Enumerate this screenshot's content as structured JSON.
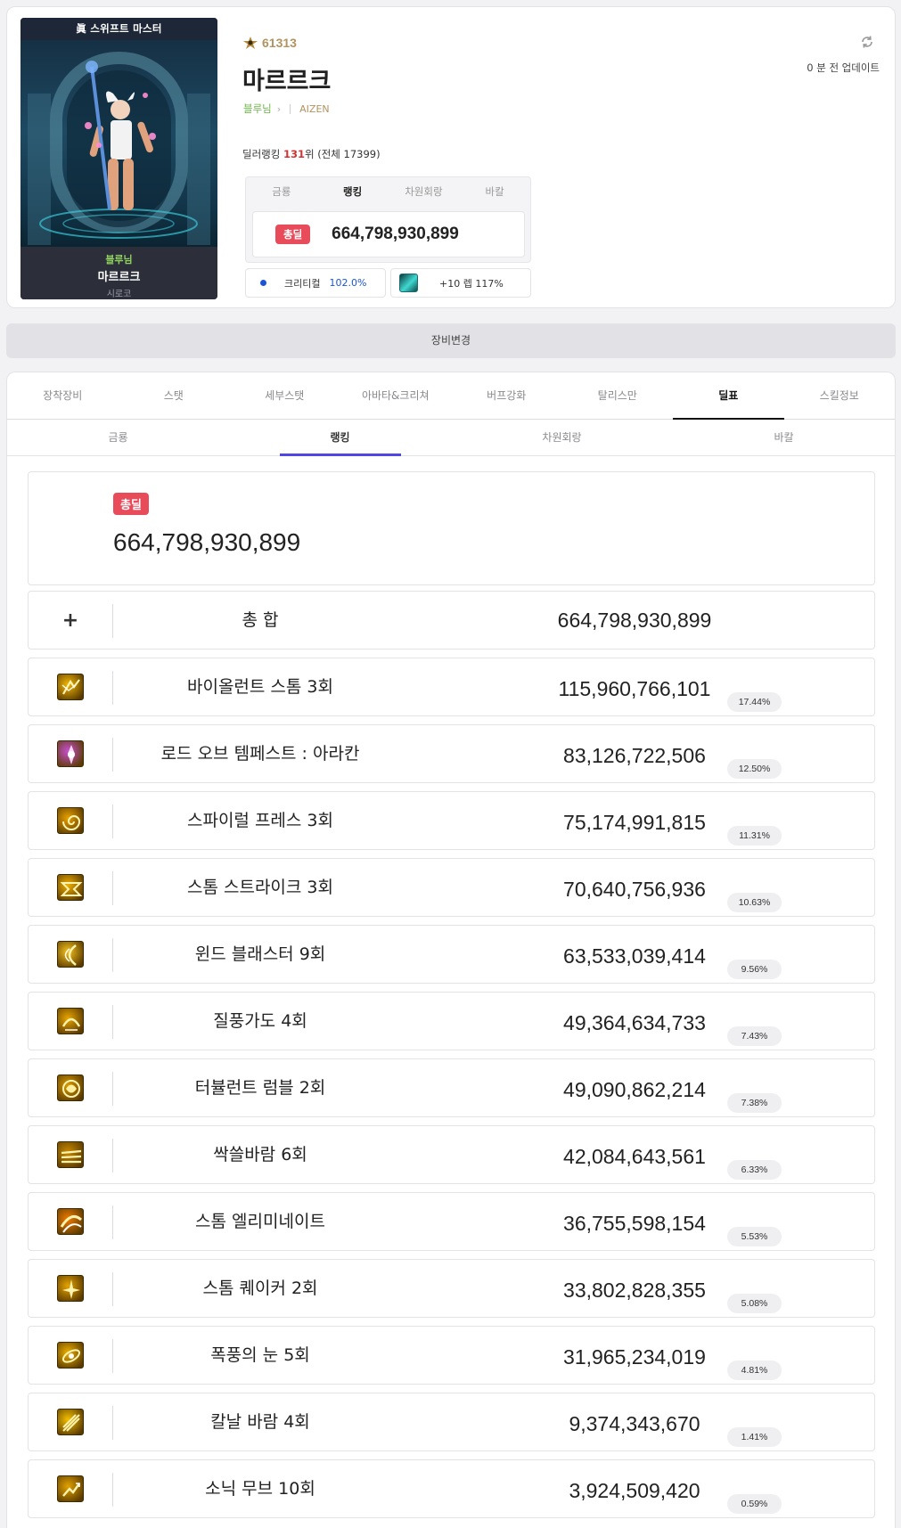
{
  "profile": {
    "job_title": "眞 스위프트 마스터",
    "fame": "61313",
    "name": "마르르크",
    "adventure": "블루님",
    "guild": "AIZEN",
    "portrait_adventure": "블루님",
    "portrait_name": "마르르크",
    "server": "시로코",
    "ranking": {
      "prefix": "딜러랭킹 ",
      "rank": "131",
      "suffix": "위 (전체 17399)"
    },
    "updated": "0 분 전 업데이트"
  },
  "rank_box": {
    "tabs": [
      "금룡",
      "랭킹",
      "차원회랑",
      "바칼"
    ],
    "active_tab": 1,
    "badge": "총딜",
    "amount": "664,798,930,899"
  },
  "chips": {
    "crit_label": "크리티컬",
    "crit_value": "102.0%",
    "weapon_label": "+10 렙 117%"
  },
  "gear_bar": "장비변경",
  "tabs": [
    "장착장비",
    "스탯",
    "세부스탯",
    "아바타&크리쳐",
    "버프강화",
    "탈리스만",
    "딜표",
    "스킬정보"
  ],
  "active_tab": 6,
  "subtabs": [
    "금룡",
    "랭킹",
    "차원회랑",
    "바칼"
  ],
  "active_subtab": 1,
  "total": {
    "badge": "총딜",
    "amount": "664,798,930,899"
  },
  "sum_row": {
    "label": "총 합",
    "amount": "664,798,930,899"
  },
  "skills": [
    {
      "name": "바이올런트 스톰 3회",
      "damage": "115,960,766,101",
      "pct": "17.44%",
      "icon": "violent-storm-icon",
      "color": "#f2b705"
    },
    {
      "name": "로드 오브 템페스트 : 아라칸",
      "damage": "83,126,722,506",
      "pct": "12.50%",
      "icon": "lord-of-tempest-icon",
      "color": "#c84fd0"
    },
    {
      "name": "스파이럴 프레스 3회",
      "damage": "75,174,991,815",
      "pct": "11.31%",
      "icon": "spiral-press-icon",
      "color": "#e8a100"
    },
    {
      "name": "스톰 스트라이크 3회",
      "damage": "70,640,756,936",
      "pct": "10.63%",
      "icon": "storm-strike-icon",
      "color": "#f0b000"
    },
    {
      "name": "윈드 블래스터 9회",
      "damage": "63,533,039,414",
      "pct": "9.56%",
      "icon": "wind-blaster-icon",
      "color": "#f5c21b"
    },
    {
      "name": "질풍가도 4회",
      "damage": "49,364,634,733",
      "pct": "7.43%",
      "icon": "gale-road-icon",
      "color": "#e9a500"
    },
    {
      "name": "터뷸런트 럼블 2회",
      "damage": "49,090,862,214",
      "pct": "7.38%",
      "icon": "turbulent-rumble-icon",
      "color": "#d89a00"
    },
    {
      "name": "싹쓸바람 6회",
      "damage": "42,084,643,561",
      "pct": "6.33%",
      "icon": "sweeping-wind-icon",
      "color": "#c98a00"
    },
    {
      "name": "스톰 엘리미네이트",
      "damage": "36,755,598,154",
      "pct": "5.53%",
      "icon": "storm-eliminate-icon",
      "color": "#f07a00"
    },
    {
      "name": "스톰 퀘이커 2회",
      "damage": "33,802,828,355",
      "pct": "5.08%",
      "icon": "storm-quaker-icon",
      "color": "#e6a300"
    },
    {
      "name": "폭풍의 눈 5회",
      "damage": "31,965,234,019",
      "pct": "4.81%",
      "icon": "eye-of-storm-icon",
      "color": "#eeb000"
    },
    {
      "name": "칼날 바람 4회",
      "damage": "9,374,343,670",
      "pct": "1.41%",
      "icon": "blade-wind-icon",
      "color": "#f4c000"
    },
    {
      "name": "소닉 무브 10회",
      "damage": "3,924,509,420",
      "pct": "0.59%",
      "icon": "sonic-move-icon",
      "color": "#e2a200"
    }
  ]
}
